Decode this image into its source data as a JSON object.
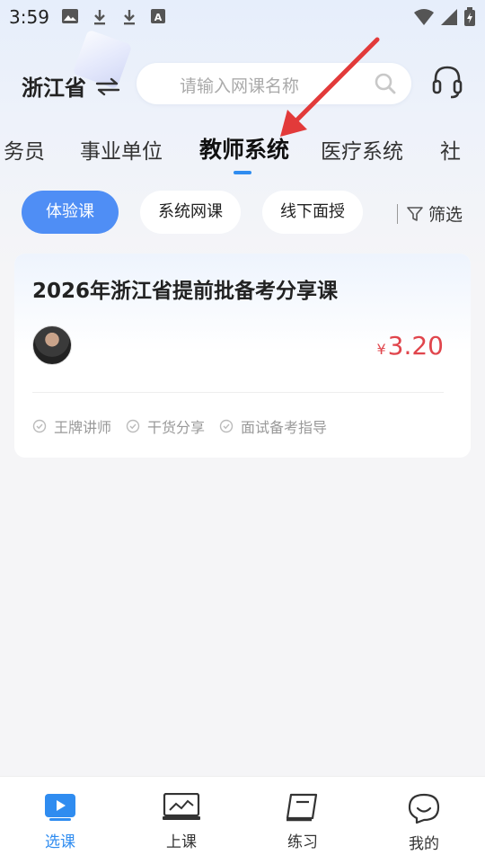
{
  "status_bar": {
    "time": "3:59",
    "icons": [
      "image-icon",
      "download-icon",
      "download-icon",
      "a-box-icon"
    ],
    "system": [
      "wifi-icon",
      "signal-icon",
      "battery-icon"
    ]
  },
  "header": {
    "province": "浙江省",
    "search_placeholder": "请输入网课名称"
  },
  "categories": {
    "items": [
      "务员",
      "事业单位",
      "教师系统",
      "医疗系统",
      "社"
    ],
    "active_index": 2
  },
  "chips": {
    "items": [
      "体验课",
      "系统网课",
      "线下面授"
    ],
    "active_index": 0,
    "filter_label": "筛选"
  },
  "course_card": {
    "title": "2026年浙江省提前批备考分享课",
    "currency": "¥",
    "price": "3.20",
    "tags": [
      "王牌讲师",
      "干货分享",
      "面试备考指导"
    ]
  },
  "bottom_nav": {
    "items": [
      {
        "label": "选课",
        "icon": "play-icon",
        "active": true
      },
      {
        "label": "上课",
        "icon": "monitor-icon",
        "active": false
      },
      {
        "label": "练习",
        "icon": "notebook-icon",
        "active": false
      },
      {
        "label": "我的",
        "icon": "smile-chat-icon",
        "active": false
      }
    ]
  },
  "colors": {
    "accent": "#2f8cf0",
    "chip_active": "#4f8ef5",
    "price": "#e0454c",
    "annotation_arrow": "#e23a3a"
  }
}
